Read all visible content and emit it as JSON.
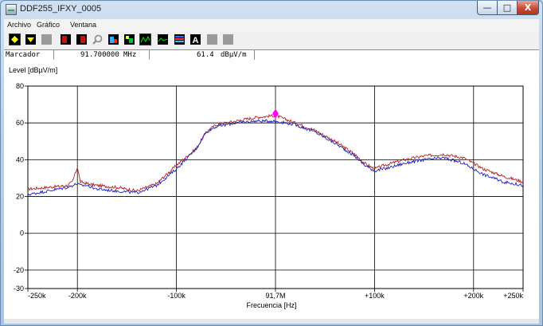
{
  "window": {
    "title": "DDF255_IFXY_0005",
    "minimize_glyph": "—",
    "maximize_glyph": "□",
    "close_glyph": "X"
  },
  "menu": [
    "Archivo",
    "Gráfico",
    "Ventana"
  ],
  "toolbar": {
    "icons": [
      "marker-up-icon",
      "marker-down-icon",
      "blank-icon",
      "red-bar-icon",
      "red-bar-alt-icon",
      "magnifier-icon",
      "spectrum-a-icon",
      "spectrum-b-icon",
      "trace-view-icon",
      "trace-green-icon",
      "waterfall-icon",
      "text-a-icon",
      "blank-icon",
      "blank-icon"
    ]
  },
  "status": {
    "label": "Marcador",
    "frequency": "91.700000",
    "frequency_unit": "MHz",
    "level": "61.4",
    "level_unit": "dBμV/m"
  },
  "chart_data": {
    "type": "line",
    "ylabel": "Level [dBµV/m]",
    "xlabel": "Frecuencia [Hz]",
    "x_ticks": [
      "-250k",
      "-200k",
      "-100k",
      "91,7M",
      "+100k",
      "+200k",
      "+250k"
    ],
    "x_tick_values": [
      -250,
      -200,
      -100,
      0,
      100,
      200,
      250
    ],
    "y_ticks": [
      "80",
      "60",
      "40",
      "20",
      "0",
      "-20",
      "-30"
    ],
    "y_tick_values": [
      80,
      60,
      40,
      20,
      0,
      -20,
      -30
    ],
    "xlim": [
      -250,
      250
    ],
    "ylim": [
      -30,
      80
    ],
    "grid": true,
    "marker": {
      "x": 0,
      "y": 65,
      "color": "#ff00ff"
    },
    "series": [
      {
        "color": "#b22222",
        "x": [
          -250,
          -230,
          -210,
          -205,
          -200,
          -197,
          -190,
          -180,
          -160,
          -140,
          -120,
          -100,
          -80,
          -70,
          -60,
          -40,
          -20,
          0,
          20,
          40,
          60,
          80,
          90,
          100,
          110,
          130,
          150,
          170,
          190,
          210,
          230,
          250
        ],
        "y": [
          24,
          25,
          26,
          28,
          36,
          28,
          27,
          26,
          25,
          23,
          27,
          37,
          46,
          55,
          59,
          61,
          63,
          64,
          60,
          56,
          50,
          43,
          38,
          35,
          37,
          40,
          42,
          43,
          41,
          35,
          31,
          28
        ]
      },
      {
        "color": "#2222bb",
        "x": [
          -250,
          -230,
          -210,
          -205,
          -200,
          -197,
          -190,
          -180,
          -160,
          -140,
          -120,
          -100,
          -80,
          -70,
          -60,
          -40,
          -20,
          0,
          20,
          40,
          60,
          80,
          90,
          100,
          110,
          130,
          150,
          170,
          190,
          210,
          230,
          250
        ],
        "y": [
          21,
          23,
          25,
          26,
          27,
          26,
          26,
          24,
          23,
          22,
          26,
          35,
          46,
          55,
          58,
          60,
          61,
          61,
          59,
          55,
          49,
          42,
          37,
          34,
          35,
          38,
          40,
          41,
          38,
          32,
          28,
          26
        ]
      }
    ]
  }
}
